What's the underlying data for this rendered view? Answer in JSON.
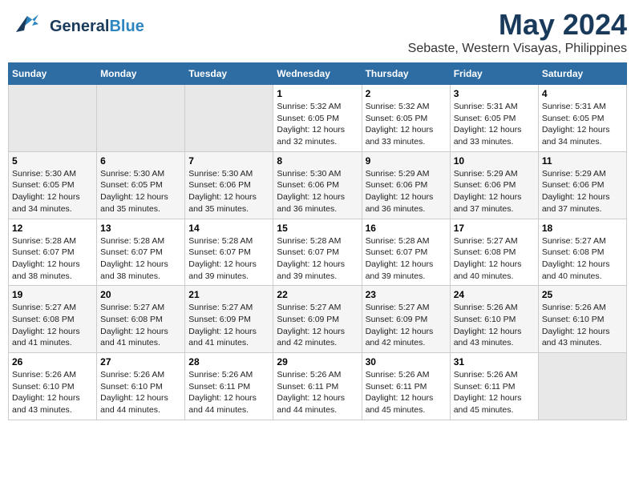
{
  "header": {
    "logo_line1": "General",
    "logo_line2": "Blue",
    "month": "May 2024",
    "location": "Sebaste, Western Visayas, Philippines"
  },
  "weekdays": [
    "Sunday",
    "Monday",
    "Tuesday",
    "Wednesday",
    "Thursday",
    "Friday",
    "Saturday"
  ],
  "weeks": [
    [
      {
        "day": "",
        "empty": true
      },
      {
        "day": "",
        "empty": true
      },
      {
        "day": "",
        "empty": true
      },
      {
        "day": "1",
        "sunrise": "5:32 AM",
        "sunset": "6:05 PM",
        "daylight": "12 hours and 32 minutes."
      },
      {
        "day": "2",
        "sunrise": "5:32 AM",
        "sunset": "6:05 PM",
        "daylight": "12 hours and 33 minutes."
      },
      {
        "day": "3",
        "sunrise": "5:31 AM",
        "sunset": "6:05 PM",
        "daylight": "12 hours and 33 minutes."
      },
      {
        "day": "4",
        "sunrise": "5:31 AM",
        "sunset": "6:05 PM",
        "daylight": "12 hours and 34 minutes."
      }
    ],
    [
      {
        "day": "5",
        "sunrise": "5:30 AM",
        "sunset": "6:05 PM",
        "daylight": "12 hours and 34 minutes."
      },
      {
        "day": "6",
        "sunrise": "5:30 AM",
        "sunset": "6:05 PM",
        "daylight": "12 hours and 35 minutes."
      },
      {
        "day": "7",
        "sunrise": "5:30 AM",
        "sunset": "6:06 PM",
        "daylight": "12 hours and 35 minutes."
      },
      {
        "day": "8",
        "sunrise": "5:30 AM",
        "sunset": "6:06 PM",
        "daylight": "12 hours and 36 minutes."
      },
      {
        "day": "9",
        "sunrise": "5:29 AM",
        "sunset": "6:06 PM",
        "daylight": "12 hours and 36 minutes."
      },
      {
        "day": "10",
        "sunrise": "5:29 AM",
        "sunset": "6:06 PM",
        "daylight": "12 hours and 37 minutes."
      },
      {
        "day": "11",
        "sunrise": "5:29 AM",
        "sunset": "6:06 PM",
        "daylight": "12 hours and 37 minutes."
      }
    ],
    [
      {
        "day": "12",
        "sunrise": "5:28 AM",
        "sunset": "6:07 PM",
        "daylight": "12 hours and 38 minutes."
      },
      {
        "day": "13",
        "sunrise": "5:28 AM",
        "sunset": "6:07 PM",
        "daylight": "12 hours and 38 minutes."
      },
      {
        "day": "14",
        "sunrise": "5:28 AM",
        "sunset": "6:07 PM",
        "daylight": "12 hours and 39 minutes."
      },
      {
        "day": "15",
        "sunrise": "5:28 AM",
        "sunset": "6:07 PM",
        "daylight": "12 hours and 39 minutes."
      },
      {
        "day": "16",
        "sunrise": "5:28 AM",
        "sunset": "6:07 PM",
        "daylight": "12 hours and 39 minutes."
      },
      {
        "day": "17",
        "sunrise": "5:27 AM",
        "sunset": "6:08 PM",
        "daylight": "12 hours and 40 minutes."
      },
      {
        "day": "18",
        "sunrise": "5:27 AM",
        "sunset": "6:08 PM",
        "daylight": "12 hours and 40 minutes."
      }
    ],
    [
      {
        "day": "19",
        "sunrise": "5:27 AM",
        "sunset": "6:08 PM",
        "daylight": "12 hours and 41 minutes."
      },
      {
        "day": "20",
        "sunrise": "5:27 AM",
        "sunset": "6:08 PM",
        "daylight": "12 hours and 41 minutes."
      },
      {
        "day": "21",
        "sunrise": "5:27 AM",
        "sunset": "6:09 PM",
        "daylight": "12 hours and 41 minutes."
      },
      {
        "day": "22",
        "sunrise": "5:27 AM",
        "sunset": "6:09 PM",
        "daylight": "12 hours and 42 minutes."
      },
      {
        "day": "23",
        "sunrise": "5:27 AM",
        "sunset": "6:09 PM",
        "daylight": "12 hours and 42 minutes."
      },
      {
        "day": "24",
        "sunrise": "5:26 AM",
        "sunset": "6:10 PM",
        "daylight": "12 hours and 43 minutes."
      },
      {
        "day": "25",
        "sunrise": "5:26 AM",
        "sunset": "6:10 PM",
        "daylight": "12 hours and 43 minutes."
      }
    ],
    [
      {
        "day": "26",
        "sunrise": "5:26 AM",
        "sunset": "6:10 PM",
        "daylight": "12 hours and 43 minutes."
      },
      {
        "day": "27",
        "sunrise": "5:26 AM",
        "sunset": "6:10 PM",
        "daylight": "12 hours and 44 minutes."
      },
      {
        "day": "28",
        "sunrise": "5:26 AM",
        "sunset": "6:11 PM",
        "daylight": "12 hours and 44 minutes."
      },
      {
        "day": "29",
        "sunrise": "5:26 AM",
        "sunset": "6:11 PM",
        "daylight": "12 hours and 44 minutes."
      },
      {
        "day": "30",
        "sunrise": "5:26 AM",
        "sunset": "6:11 PM",
        "daylight": "12 hours and 45 minutes."
      },
      {
        "day": "31",
        "sunrise": "5:26 AM",
        "sunset": "6:11 PM",
        "daylight": "12 hours and 45 minutes."
      },
      {
        "day": "",
        "empty": true
      }
    ]
  ],
  "labels": {
    "sunrise": "Sunrise:",
    "sunset": "Sunset:",
    "daylight": "Daylight:"
  }
}
